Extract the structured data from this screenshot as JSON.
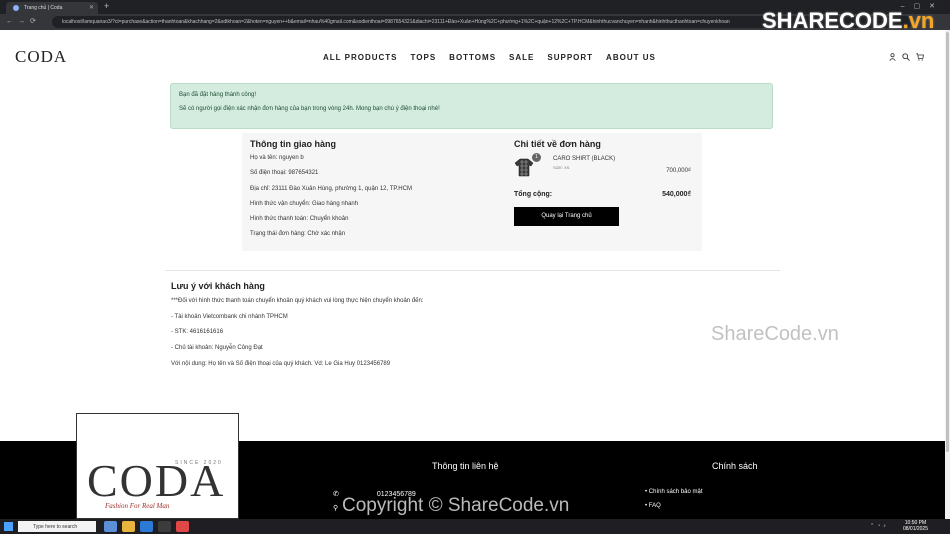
{
  "browser": {
    "tab_title": "Trang chủ | Coda",
    "url": "localhost/lamquanao3/?ct=purchase&action=thanhtoan&khachhang=2&sdtkhoan=2&hoten=nguyen++b&email=nhau%40gmail.com&sodienthoai=0987654321&diachi=23111+Đào+Xuân+Hùng%2C+phường+1%2C+quận+12%2C+TP.HCM&hinhthucvanchuyen=nhanh&hinhthucthanhtoan=chuyenkhoan"
  },
  "header": {
    "logo": "CODA",
    "menu": [
      "ALL PRODUCTS",
      "TOPS",
      "BOTTOMS",
      "SALE",
      "SUPPORT",
      "ABOUT US"
    ]
  },
  "alert": {
    "line1": "Bạn đã đặt hàng thành công!",
    "line2": "Sẽ có người gọi điện xác nhận đơn hàng của bạn trong vòng 24h. Mong bạn chú ý điện thoại nhé!"
  },
  "shipping": {
    "title": "Thông tin giao hàng",
    "rows": [
      "Họ và tên: nguyen b",
      "Số điện thoại: 987654321",
      "Địa chỉ: 23111 Đào Xuân Hùng, phường 1, quận 12, TP.HCM",
      "Hình thức vận chuyển: Giao hàng nhanh",
      "Hình thức thanh toán: Chuyển khoản",
      "Trạng thái đơn hàng: Chờ xác nhận"
    ]
  },
  "order": {
    "title": "Chi tiết về đơn hàng",
    "product": {
      "name": "CARO SHIRT (BLACK)",
      "size": "SIZE: XS",
      "qty": "1",
      "price": "700,000₫"
    },
    "total_label": "Tổng cộng:",
    "total_value": "540,000₫",
    "back_label": "Quay lại Trang chủ"
  },
  "notice": {
    "title": "Lưu ý với khách hàng",
    "lines": [
      "***Đối với hình thức thanh toán chuyển khoản quý khách vui lòng thực hiện chuyển khoản đến:",
      "- Tài khoản Vietcombank chi nhánh TPHCM",
      "- STK: 4616161616",
      "- Chủ tài khoản: Nguyễn Công Đạt",
      "Với nội dung: Họ tên và Số điện thoại của quý khách. Vd: Le Gia Huy 0123456789"
    ]
  },
  "footer": {
    "logo_text": "CODA",
    "since": "SINCE 2020",
    "tagline": "Fashion For Real Man",
    "contact_title": "Thông tin liên hệ",
    "phone": "0123456789",
    "policy_title": "Chính sách",
    "links": [
      "Chính sách bảo mật",
      "FAQ"
    ]
  },
  "watermarks": {
    "top": "SHARECODE",
    "top_suffix": ".vn",
    "mid": "ShareCode.vn",
    "bottom": "Copyright © ShareCode.vn"
  },
  "taskbar": {
    "search_placeholder": "Type here to search",
    "time": "10:50 PM",
    "date": "08/01/2025"
  }
}
